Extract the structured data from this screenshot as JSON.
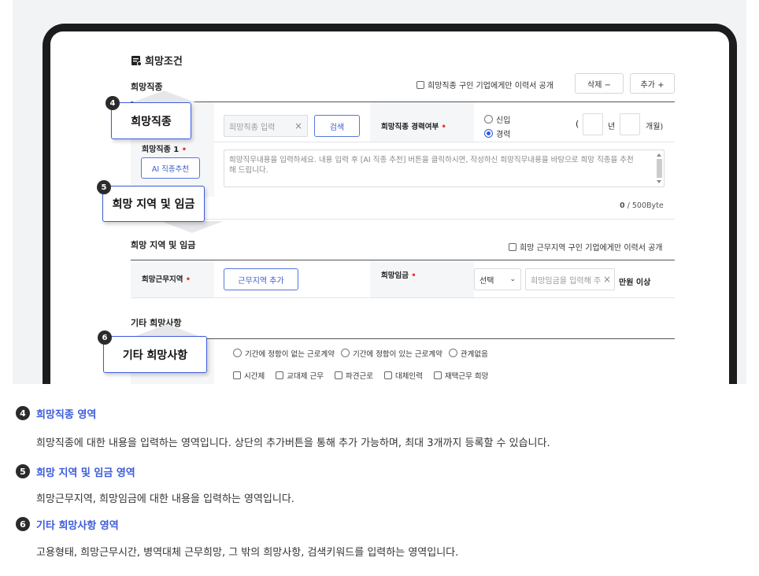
{
  "section_title": "희망조건",
  "job": {
    "header": "희망직종",
    "public_checkbox": "희망직종 구인 기업에게만 이력서 공개",
    "delete_button": "삭제 −",
    "add_button": "추가 +",
    "label": "희망직종 1",
    "input_placeholder": "희망직종 입력",
    "input_clear": "×",
    "search_button": "검색",
    "career_label": "희망직종 경력여부",
    "radio_new": "신입",
    "radio_exp": "경력",
    "paren_open": "(",
    "year_unit": "년",
    "month_unit": "개월)",
    "ai_button": "AI 직종추천",
    "textarea_placeholder": "희망직무내용을 입력하세요. 내용 입력 후 [AI 직종 추천] 버튼을 클릭하시면, 작성하신 희망직무내용을 바탕으로 희망 직종을 추천해 드립니다.",
    "byte_count": "0",
    "byte_max": "/ 500Byte"
  },
  "region": {
    "header": "희망 지역 및 임금",
    "public_checkbox": "희망 근무지역 구인 기업에게만 이력서 공개",
    "area_label": "희망근무지역",
    "area_button": "근무지역 추가",
    "wage_label": "희망임금",
    "wage_select": "선택",
    "wage_placeholder": "희망임금을 입력해 주",
    "wage_clear": "×",
    "wage_unit": "만원 이상"
  },
  "etc": {
    "header": "기타 희망사항",
    "radios": [
      "기간에 정함이 없는 근로계약",
      "기간에 정함이 있는 근로계약",
      "관계없음"
    ],
    "checks": [
      "시간제",
      "교대제 근무",
      "파견근로",
      "대체인력",
      "재택근무 희망"
    ]
  },
  "callouts": [
    {
      "num": "4",
      "label": "희망직종"
    },
    {
      "num": "5",
      "label": "희망 지역 및 임금"
    },
    {
      "num": "6",
      "label": "기타 희망사항"
    }
  ],
  "descriptions": [
    {
      "num": "4",
      "title": "희망직종 영역",
      "body": "희망직종에 대한 내용을 입력하는 영역입니다. 상단의 추가버튼을 통해 추가 가능하며, 최대 3개까지 등록할 수 있습니다."
    },
    {
      "num": "5",
      "title": "희망 지역 및 임금 영역",
      "body": "희망근무지역, 희망임금에 대한 내용을 입력하는 영역입니다."
    },
    {
      "num": "6",
      "title": "기타 희망사항 영역",
      "body": "고용형태, 희망근무시간, 병역대체 근무희망, 그 밖의 희망사항, 검색키워드를 입력하는 영역입니다."
    }
  ],
  "colors": {
    "accent": "#3b5bdb",
    "required": "#e8323c"
  }
}
